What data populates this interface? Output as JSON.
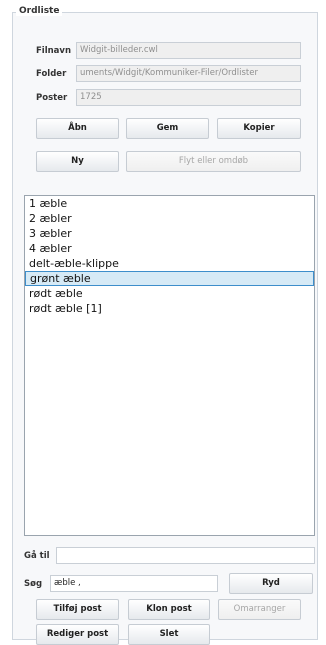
{
  "panel": {
    "title": "Ordliste"
  },
  "fields": {
    "filnavn": {
      "label": "Filnavn",
      "value": "Widgit-billeder.cwl"
    },
    "folder": {
      "label": "Folder",
      "value": "uments/Widgit/Kommuniker-Filer/Ordlister"
    },
    "poster": {
      "label": "Poster",
      "value": "1725"
    }
  },
  "buttons": {
    "aabn": "Åbn",
    "gem": "Gem",
    "kopier": "Kopier",
    "ny": "Ny",
    "flyt": "Flyt eller omdøb"
  },
  "list": {
    "items": [
      "1 æble",
      "2 æbler",
      "3 æbler",
      "4 æbler",
      "delt-æble-klippe",
      "grønt æble",
      "rødt æble",
      "rødt æble [1]"
    ],
    "selected_index": 5
  },
  "goto": {
    "label": "Gå til",
    "value": ""
  },
  "search": {
    "label": "Søg",
    "value": "æble  ,",
    "clear_label": "Ryd"
  },
  "actions": {
    "tilfoej": "Tilføj post",
    "klon": "Klon post",
    "omarranger": "Omarranger",
    "rediger": "Rediger post",
    "slet": "Slet"
  }
}
